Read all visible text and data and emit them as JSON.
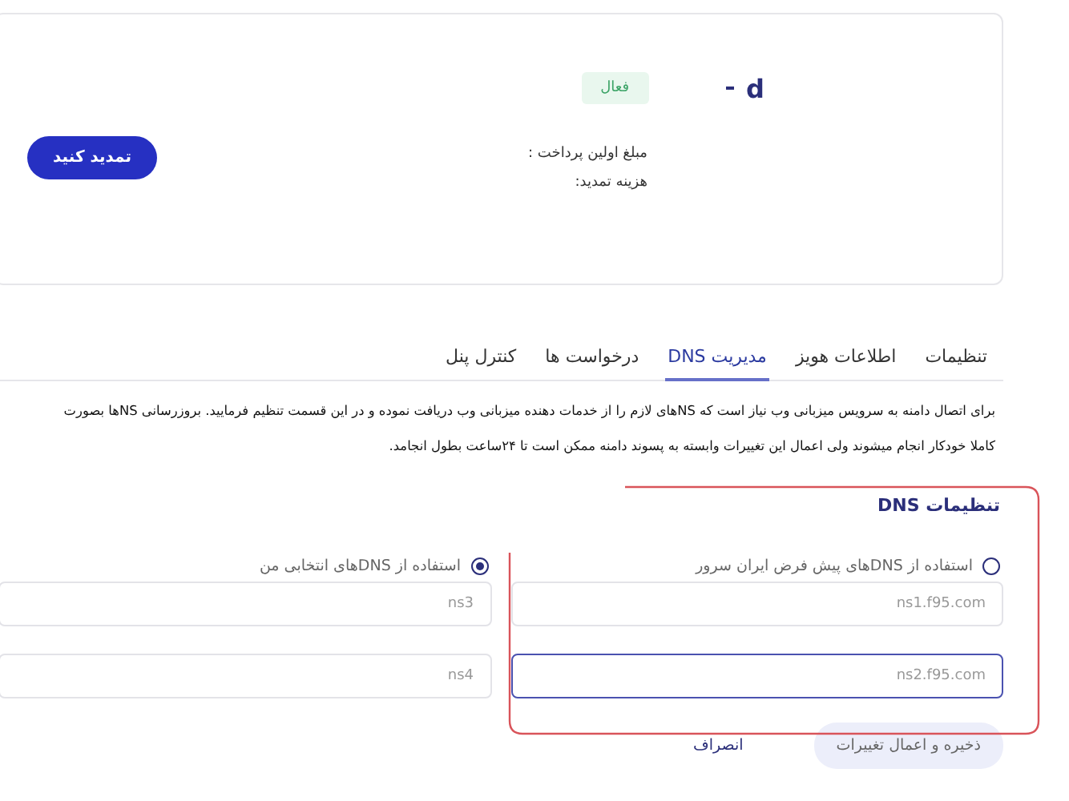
{
  "domain": {
    "name": "d",
    "status": "فعال",
    "details": [
      {
        "label": "مبلغ اولین پرداخت :"
      },
      {
        "label": "هزینه تمدید:"
      }
    ],
    "renew_button": "تمدید کنید"
  },
  "tabs": [
    {
      "label": "تنظیمات",
      "selected": false
    },
    {
      "label": "اطلاعات هویز",
      "selected": false
    },
    {
      "label": "مدیریت DNS",
      "selected": true
    },
    {
      "label": "درخواست ها",
      "selected": false
    },
    {
      "label": "کنترل پنل",
      "selected": false
    }
  ],
  "description": [
    "برای اتصال دامنه به سرویس میزبانی وب نیاز است که NSهای لازم را از خدمات دهنده میزبانی وب دریافت نموده و در این قسمت تنظیم فرمایید. بروزرسانی NSها بصورت",
    "کاملا خودکار انجام میشوند ولی اعمال این تغییرات وابسته به پسوند دامنه ممکن است تا ۲۴ساعت بطول انجامد."
  ],
  "dns_settings": {
    "title": "تنظیمات DNS",
    "options": [
      {
        "label": "استفاده از DNSهای پیش فرض ایران سرور",
        "selected": false,
        "fields": [
          {
            "placeholder": "ns1.f95.com",
            "focused": false
          },
          {
            "placeholder": "ns2.f95.com",
            "focused": true
          }
        ]
      },
      {
        "label": "استفاده از DNSهای انتخابی من",
        "selected": true,
        "fields": [
          {
            "placeholder": "ns3",
            "focused": false
          },
          {
            "placeholder": "ns4",
            "focused": false
          }
        ]
      }
    ]
  },
  "buttons": {
    "save": "ذخیره و اعمال تغییرات",
    "cancel": "انصراف"
  }
}
